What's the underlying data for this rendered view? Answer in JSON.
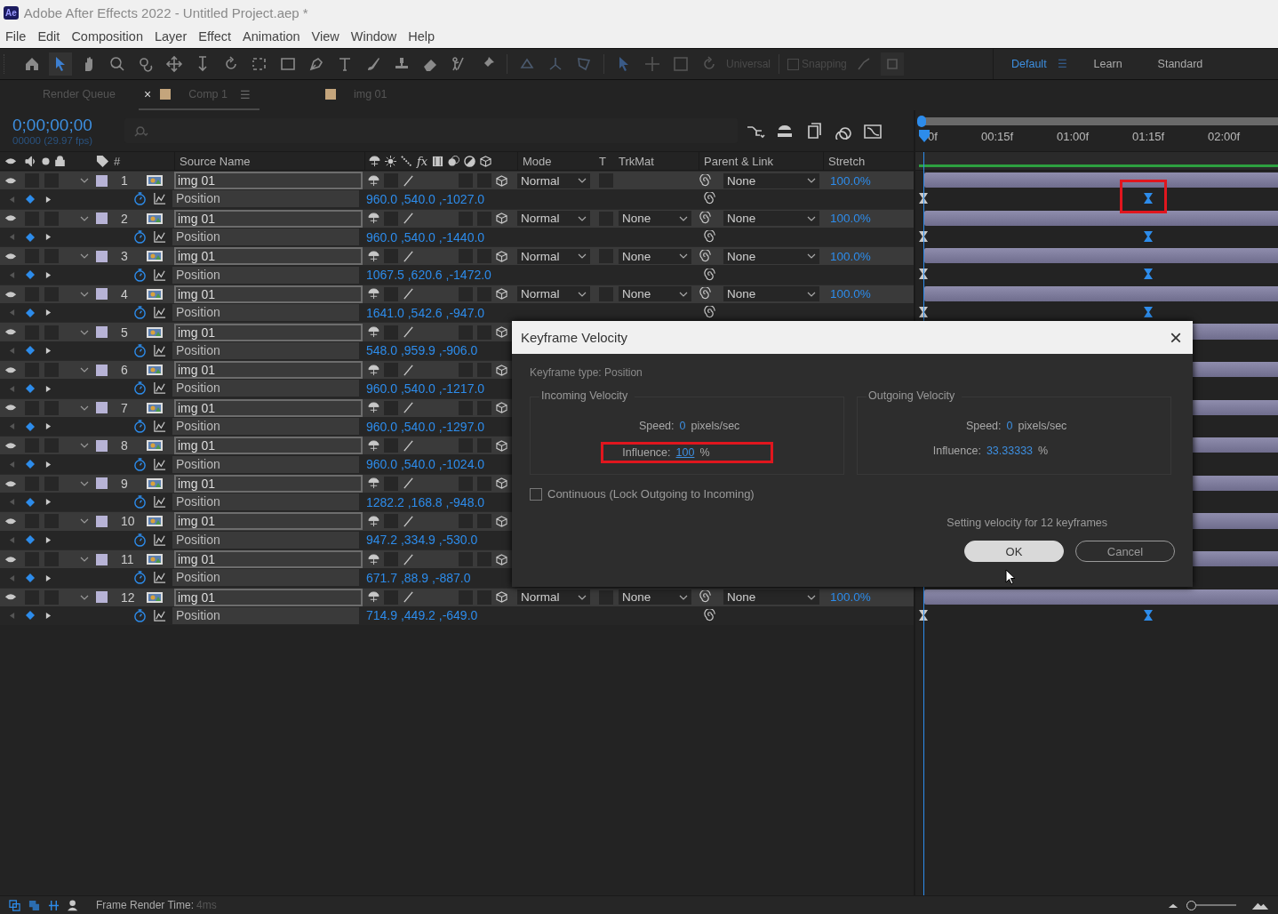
{
  "app": {
    "logo": "Ae",
    "title": "Adobe After Effects 2022 - Untitled Project.aep *"
  },
  "menu": [
    "File",
    "Edit",
    "Composition",
    "Layer",
    "Effect",
    "Animation",
    "View",
    "Window",
    "Help"
  ],
  "toolbar": {
    "universal": "Universal",
    "snapping": {
      "label": "Snapping",
      "checked": false
    },
    "workspace_menu": "☰",
    "workspaces": [
      {
        "label": "Default",
        "selected": true
      },
      {
        "label": "Learn",
        "selected": false
      },
      {
        "label": "Standard",
        "selected": false
      }
    ]
  },
  "panel_tabs": [
    {
      "kind": "queue",
      "label": "Render Queue",
      "selected": false
    },
    {
      "kind": "comp",
      "label": "Comp 1",
      "selected": true,
      "close": "×",
      "menu": "☰",
      "color": "#c4a57c"
    },
    {
      "kind": "comp",
      "label": "img 01",
      "selected": false,
      "color": "#c4a57c"
    }
  ],
  "timecode": "0;00;00;00",
  "frame_info": "00000 (29.97 fps)",
  "columns": {
    "number": "#",
    "source": "Source Name",
    "fx": "fx",
    "mode": "Mode",
    "t": "T",
    "trkmat": "TrkMat",
    "parent": "Parent & Link",
    "stretch": "Stretch"
  },
  "ruler": [
    "0f",
    "00:15f",
    "01:00f",
    "01:15f",
    "02:00f"
  ],
  "layers": [
    {
      "number": "1",
      "name": "img 01",
      "visible": true,
      "property": "Position",
      "value": "960.0 ,540.0 ,-1027.0",
      "mode": "Normal",
      "parent": "None",
      "stretch": "100.0%"
    },
    {
      "number": "2",
      "name": "img 01",
      "visible": true,
      "property": "Position",
      "value": "960.0 ,540.0 ,-1440.0",
      "mode": "Normal",
      "trkmat": "None",
      "parent": "None",
      "stretch": "100.0%"
    },
    {
      "number": "3",
      "name": "img 01",
      "visible": true,
      "property": "Position",
      "value": "1067.5 ,620.6 ,-1472.0",
      "mode": "Normal",
      "trkmat": "None",
      "parent": "None",
      "stretch": "100.0%"
    },
    {
      "number": "4",
      "name": "img 01",
      "visible": true,
      "property": "Position",
      "value": "1641.0 ,542.6 ,-947.0",
      "mode": "Normal",
      "trkmat": "None",
      "parent": "None",
      "stretch": "100.0%"
    },
    {
      "number": "5",
      "name": "img 01",
      "visible": true,
      "property": "Position",
      "value": "548.0 ,959.9 ,-906.0"
    },
    {
      "number": "6",
      "name": "img 01",
      "visible": true,
      "property": "Position",
      "value": "960.0 ,540.0 ,-1217.0"
    },
    {
      "number": "7",
      "name": "img 01",
      "visible": true,
      "property": "Position",
      "value": "960.0 ,540.0 ,-1297.0"
    },
    {
      "number": "8",
      "name": "img 01",
      "visible": true,
      "property": "Position",
      "value": "960.0 ,540.0 ,-1024.0"
    },
    {
      "number": "9",
      "name": "img 01",
      "visible": true,
      "property": "Position",
      "value": "1282.2 ,168.8 ,-948.0"
    },
    {
      "number": "10",
      "name": "img 01",
      "visible": true,
      "property": "Position",
      "value": "947.2 ,334.9 ,-530.0"
    },
    {
      "number": "11",
      "name": "img 01",
      "visible": true,
      "property": "Position",
      "value": "671.7 ,88.9 ,-887.0"
    },
    {
      "number": "12",
      "name": "img 01",
      "visible": true,
      "property": "Position",
      "value": "714.9 ,449.2 ,-649.0",
      "mode": "Normal",
      "trkmat": "None",
      "parent": "None",
      "stretch": "100.0%"
    }
  ],
  "dialog": {
    "title": "Keyframe Velocity",
    "close": "×",
    "type_label": "Keyframe type: Position",
    "groups": [
      {
        "title": "Incoming Velocity",
        "speed_label": "Speed:",
        "speed": "0",
        "speed_unit": "pixels/sec",
        "influence_label": "Influence:",
        "influence": "100",
        "influence_unit": "%",
        "highlighted": true
      },
      {
        "title": "Outgoing Velocity",
        "speed_label": "Speed:",
        "speed": "0",
        "speed_unit": "pixels/sec",
        "influence_label": "Influence:",
        "influence": "33.33333",
        "influence_unit": "%",
        "highlighted": false
      }
    ],
    "continuous": {
      "label": "Continuous (Lock Outgoing to Incoming)",
      "checked": false
    },
    "note": "Setting velocity for 12 keyframes",
    "buttons": [
      {
        "label": "OK",
        "kind": "primary"
      },
      {
        "label": "Cancel",
        "kind": "secondary"
      }
    ]
  },
  "status": {
    "label": "Frame Render Time:",
    "value": "4ms",
    "zoom": {
      "level": 0
    }
  }
}
